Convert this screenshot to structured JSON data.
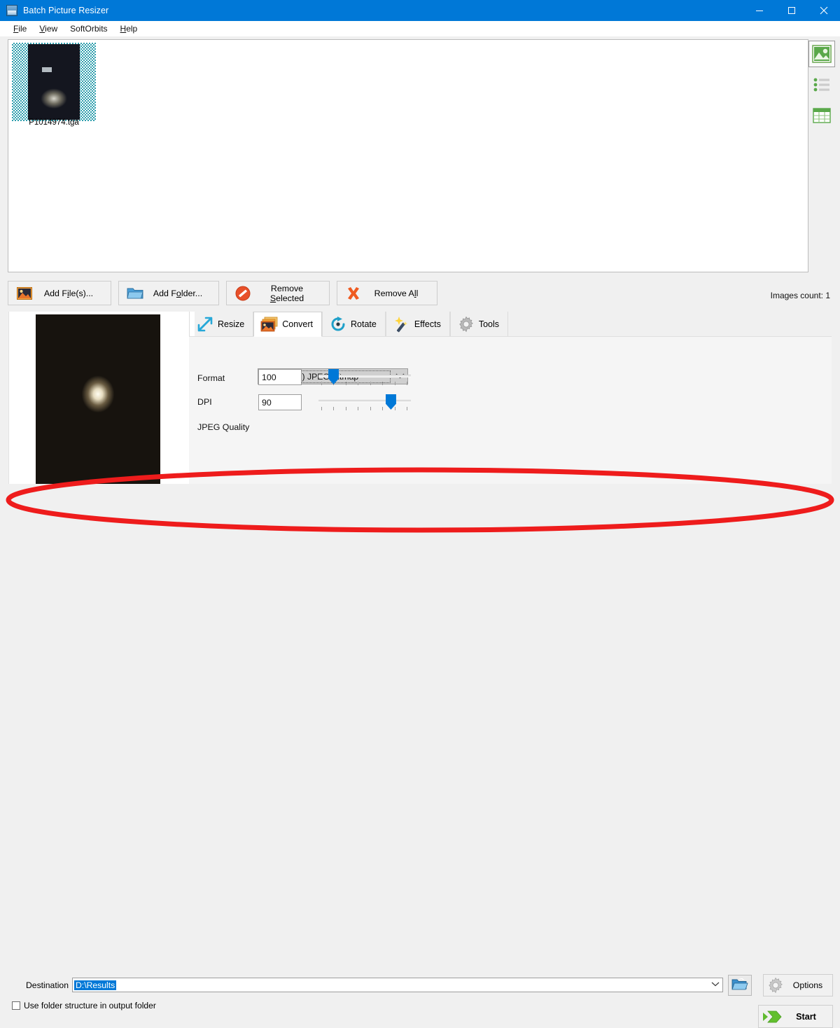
{
  "window": {
    "title": "Batch Picture Resizer",
    "icon": "app-icon",
    "controls": {
      "minimize": "─",
      "maximize": "□",
      "close": "✕"
    }
  },
  "menubar": {
    "items": [
      {
        "label": "File",
        "accel": "F"
      },
      {
        "label": "View",
        "accel": "V"
      },
      {
        "label": "SoftOrbits",
        "accel": ""
      },
      {
        "label": "Help",
        "accel": "H"
      }
    ]
  },
  "filelist": {
    "items": [
      {
        "filename": "P1014974.tga",
        "selected": true
      }
    ],
    "images_count": "Images count: 1"
  },
  "view_modes": [
    {
      "name": "thumbnail-view",
      "selected": true
    },
    {
      "name": "list-view",
      "selected": false
    },
    {
      "name": "details-view",
      "selected": false
    }
  ],
  "toolbar": {
    "add_files": "Add File(s)...",
    "add_folder": "Add Folder...",
    "remove_selected": "Remove Selected",
    "remove_all": "Remove All"
  },
  "tabs": [
    {
      "label": "Resize",
      "icon": "resize-arrows-icon",
      "active": false
    },
    {
      "label": "Convert",
      "icon": "convert-images-icon",
      "active": true
    },
    {
      "label": "Rotate",
      "icon": "rotate-arrow-icon",
      "active": false
    },
    {
      "label": "Effects",
      "icon": "magic-wand-icon",
      "active": false
    },
    {
      "label": "Tools",
      "icon": "gear-icon",
      "active": false
    }
  ],
  "convert_panel": {
    "format_label": "Format",
    "format_value": "JPG (*.jpg) JPEG Bitmap",
    "dpi_label": "DPI",
    "dpi_value": "100",
    "dpi_slider_percent": 12,
    "jpeg_label": "JPEG Quality",
    "jpeg_value": "90",
    "jpeg_slider_percent": 82
  },
  "destination": {
    "label": "Destination",
    "value": "D:\\Results",
    "browse_icon": "folder-open-icon",
    "options_label": "Options",
    "options_icon": "gear-icon",
    "checkbox_label": "Use folder structure in output folder",
    "checkbox_checked": false,
    "start_label": "Start",
    "start_icon": "green-arrow-icon"
  },
  "annotation": {
    "shape": "ellipse",
    "color": "#ee1c1c",
    "stroke_width": 7
  }
}
